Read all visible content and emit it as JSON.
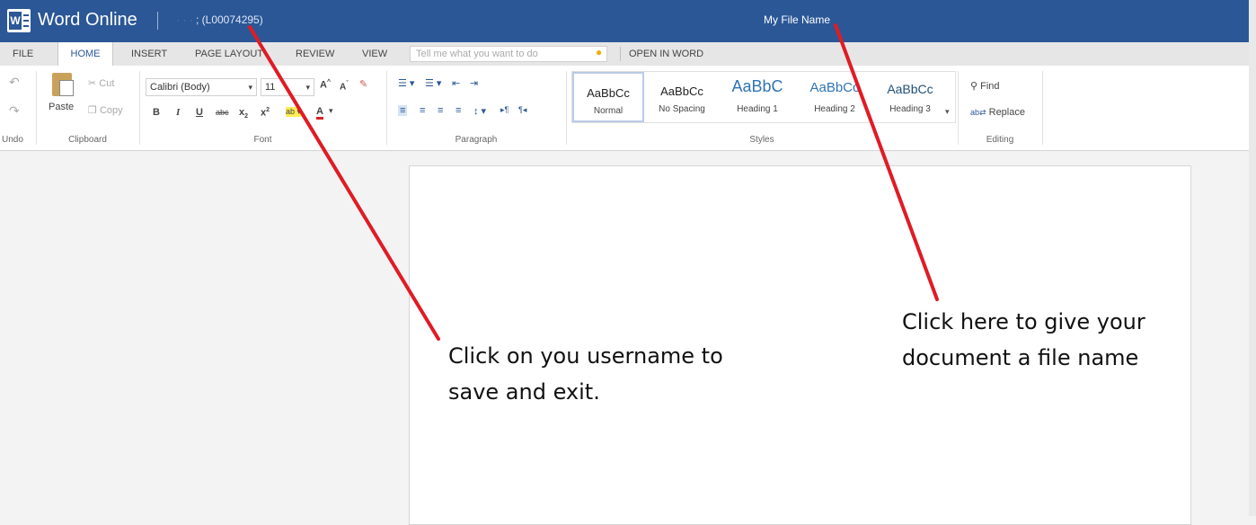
{
  "titlebar": {
    "app_name": "Word Online",
    "username_blurred": "· · ·",
    "username_id": "; (L00074295)",
    "file_name": "My File Name"
  },
  "tabs": {
    "file": "FILE",
    "home": "HOME",
    "insert": "INSERT",
    "page_layout": "PAGE LAYOUT",
    "review": "REVIEW",
    "view": "VIEW",
    "tell_me_placeholder": "Tell me what you want to do",
    "open_in_word": "OPEN IN WORD"
  },
  "ribbon": {
    "undo": {
      "label": "Undo"
    },
    "clipboard": {
      "label": "Clipboard",
      "paste": "Paste",
      "cut": "Cut",
      "copy": "Copy"
    },
    "font": {
      "label": "Font",
      "name": "Calibri (Body)",
      "size": "11"
    },
    "paragraph": {
      "label": "Paragraph"
    },
    "styles": {
      "label": "Styles",
      "items": [
        {
          "sample": "AaBbCc",
          "name": "Normal"
        },
        {
          "sample": "AaBbCc",
          "name": "No Spacing"
        },
        {
          "sample": "AaBbC",
          "name": "Heading 1"
        },
        {
          "sample": "AaBbCc",
          "name": "Heading 2"
        },
        {
          "sample": "AaBbCc",
          "name": "Heading 3"
        }
      ]
    },
    "editing": {
      "label": "Editing",
      "find": "Find",
      "replace": "Replace"
    }
  },
  "annotations": {
    "username_line1": "Click on you username to",
    "username_line2": "save and exit.",
    "filename_line1": "Click here to give your",
    "filename_line2": "document a file name"
  },
  "colors": {
    "titlebar": "#2b5797",
    "annotation_arrow": "#e01b24"
  }
}
